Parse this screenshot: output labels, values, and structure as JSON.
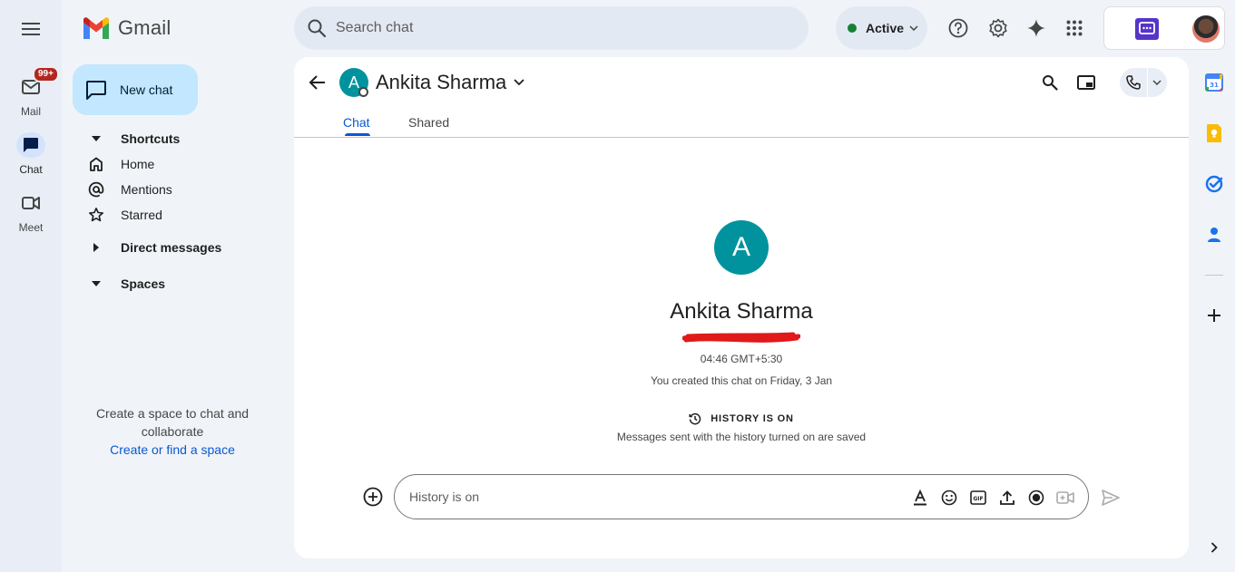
{
  "rail": {
    "mail_label": "Mail",
    "mail_badge": "99+",
    "chat_label": "Chat",
    "meet_label": "Meet"
  },
  "logo": {
    "text": "Gmail"
  },
  "search": {
    "placeholder": "Search chat"
  },
  "status": {
    "label": "Active",
    "color": "#188038"
  },
  "sidebar": {
    "new_chat_label": "New chat",
    "shortcuts_label": "Shortcuts",
    "items": [
      {
        "label": "Home",
        "icon": "home-icon"
      },
      {
        "label": "Mentions",
        "icon": "at-icon"
      },
      {
        "label": "Starred",
        "icon": "star-icon"
      }
    ],
    "direct_messages_label": "Direct messages",
    "spaces_label": "Spaces",
    "empty_text": "Create a space to chat and collaborate",
    "empty_link": "Create or find a space"
  },
  "conversation": {
    "avatar_letter": "A",
    "name": "Ankita Sharma",
    "tabs": [
      {
        "label": "Chat",
        "active": true
      },
      {
        "label": "Shared",
        "active": false
      }
    ],
    "time": "04:46 GMT+5:30",
    "created_text": "You created this chat on Friday, 3 Jan",
    "history_title": "HISTORY IS ON",
    "history_text": "Messages sent with the history turned on are saved",
    "compose_placeholder": "History is on"
  },
  "colors": {
    "accent": "#0b57d0",
    "avatar": "#00939e",
    "new_chat_bg": "#c2e7ff",
    "redaction": "#e0191a"
  }
}
